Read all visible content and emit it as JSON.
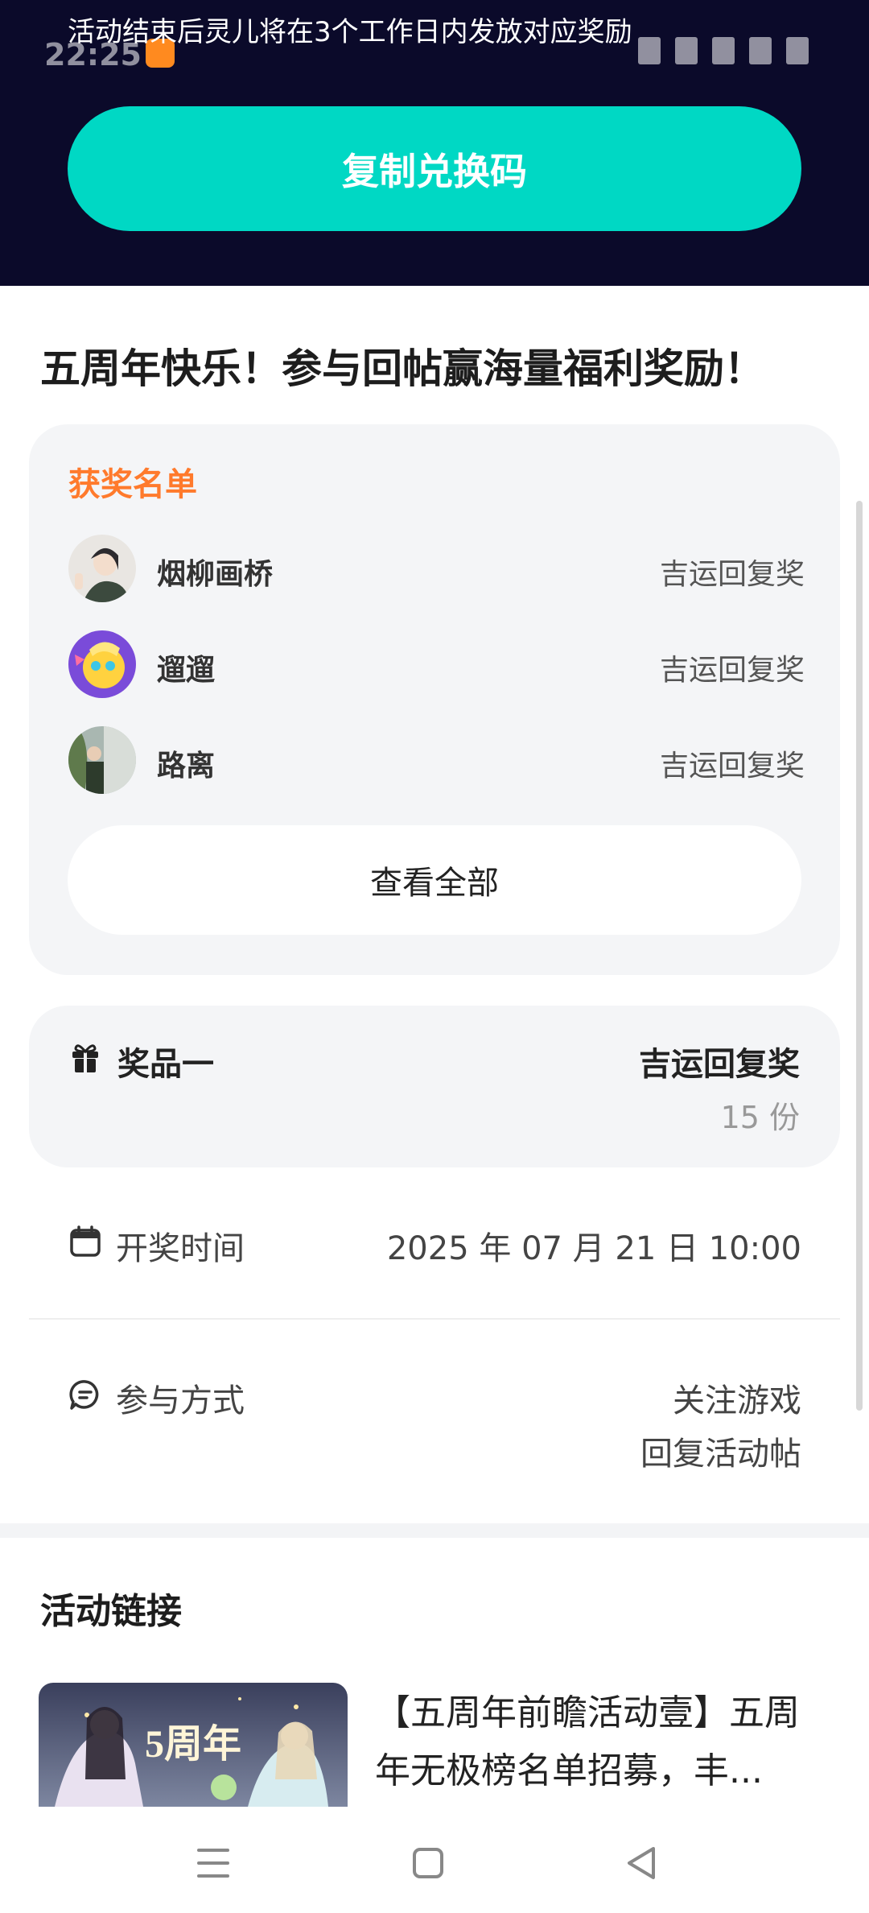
{
  "status_bar": {
    "time": "22:25"
  },
  "banner": {
    "notice": "活动结束后灵儿将在3个工作日内发放对应奖励",
    "copy_button": "复制兑换码"
  },
  "page": {
    "title": "五周年快乐！参与回帖赢海量福利奖励！"
  },
  "winners": {
    "title": "获奖名单",
    "list": [
      {
        "name": "烟柳画桥",
        "award": "吉运回复奖"
      },
      {
        "name": "遛遛",
        "award": "吉运回复奖"
      },
      {
        "name": "路离",
        "award": "吉运回复奖"
      }
    ],
    "view_all": "查看全部"
  },
  "prize": {
    "label": "奖品一",
    "name": "吉运回复奖",
    "count": "15 份"
  },
  "draw_time": {
    "label": "开奖时间",
    "value": "2025 年 07 月 21 日 10:00"
  },
  "participation": {
    "label": "参与方式",
    "line1": "关注游戏",
    "line2": "回复活动帖"
  },
  "links": {
    "title": "活动链接",
    "item": {
      "text": "【五周年前瞻活动壹】五周年无极榜名单招募，丰..."
    }
  },
  "colors": {
    "banner_bg": "#0b0a2a",
    "accent_teal": "#00d8c4",
    "winners_title": "#ff7a2c",
    "card_bg": "#f4f5f7"
  },
  "icons": [
    "gift-icon",
    "calendar-icon",
    "chat-icon",
    "menu-icon",
    "home-icon",
    "back-icon"
  ]
}
